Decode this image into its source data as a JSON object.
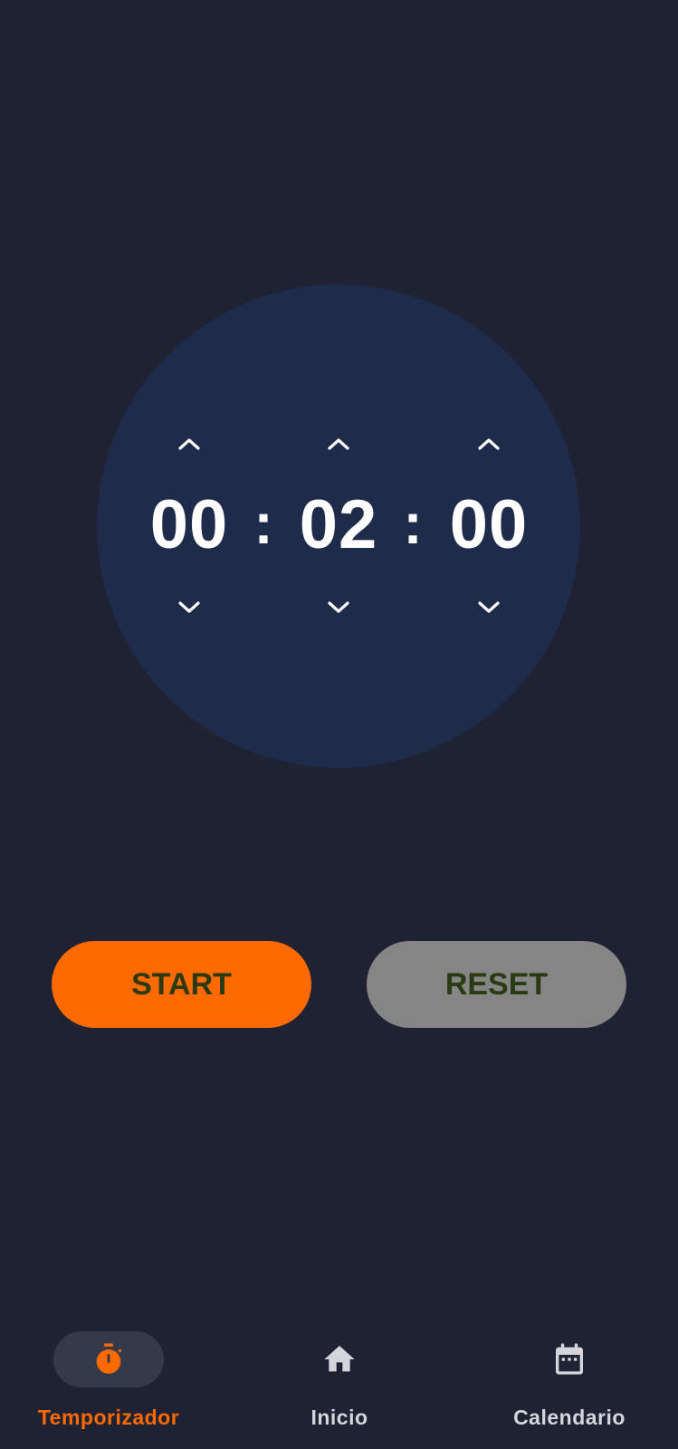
{
  "timer": {
    "hours": "00",
    "minutes": "02",
    "seconds": "00",
    "separator": ":"
  },
  "controls": {
    "start_label": "START",
    "reset_label": "RESET"
  },
  "bottom_nav": {
    "items": [
      {
        "label": "Temporizador",
        "icon": "stopwatch-icon",
        "active": true
      },
      {
        "label": "Inicio",
        "icon": "home-icon",
        "active": false
      },
      {
        "label": "Calendario",
        "icon": "calendar-icon",
        "active": false
      }
    ]
  },
  "colors": {
    "background": "#1e2233",
    "dial": "#1f2b4a",
    "accent": "#ff6a00",
    "reset_button": "#858585",
    "button_text": "#2a3a12",
    "nav_inactive": "#d4d6dc"
  }
}
